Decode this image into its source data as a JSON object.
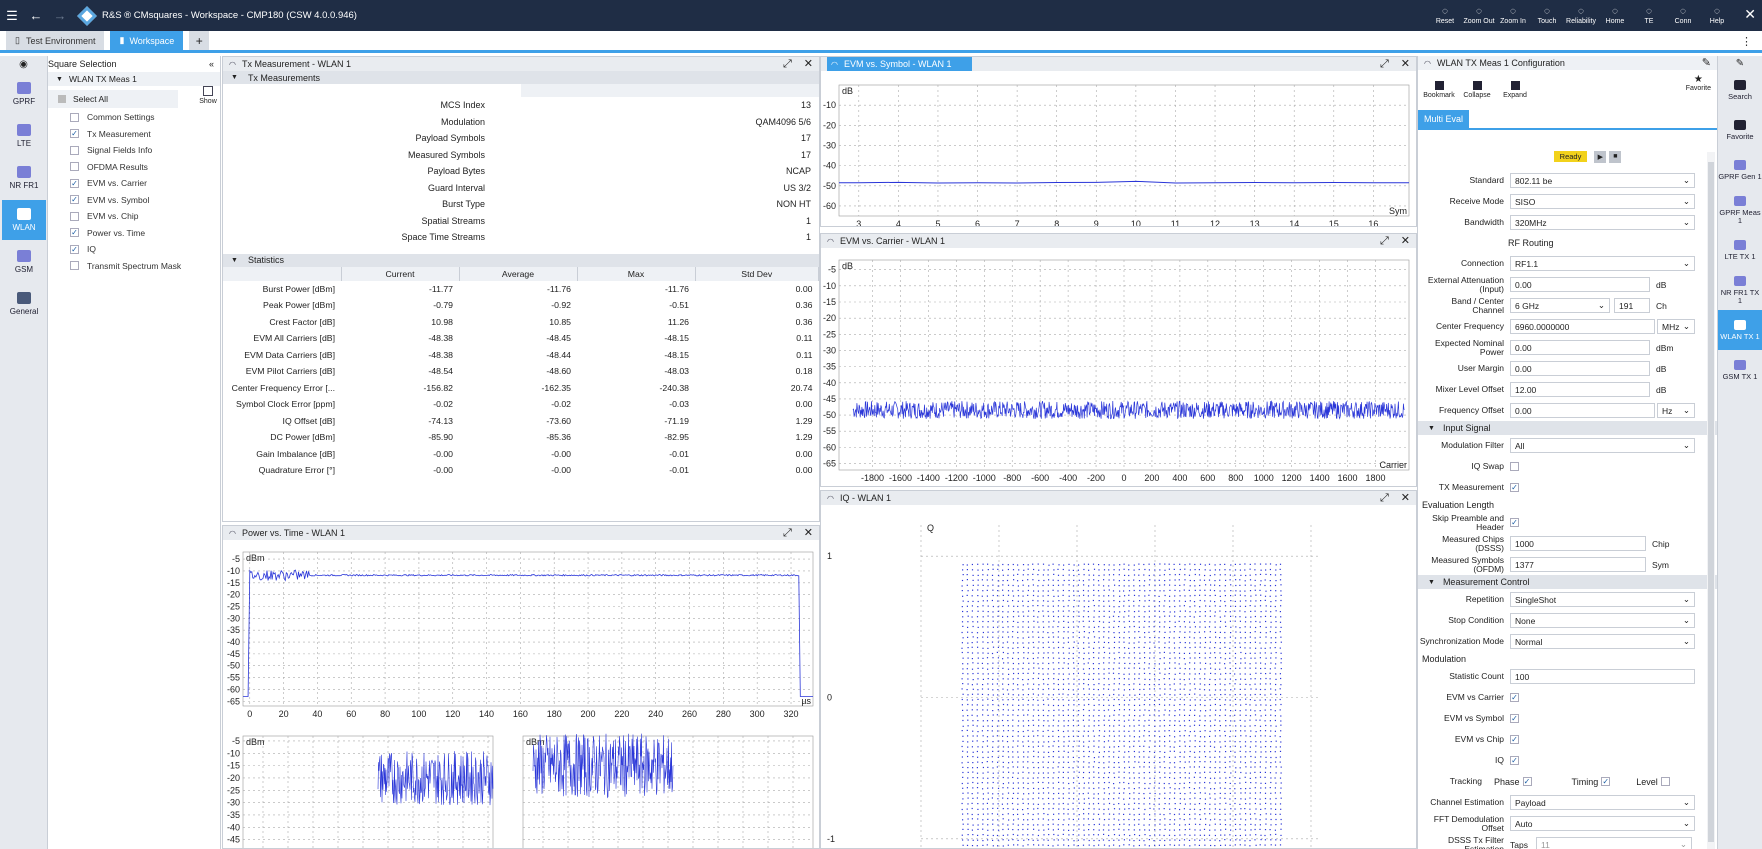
{
  "window": {
    "title": "R&S ® CMsquares - Workspace - CMP180 (CSW 4.0.0.946)"
  },
  "toolbar": [
    {
      "label": "Reset",
      "icon": "reset-icon"
    },
    {
      "label": "Zoom Out",
      "icon": "zoom-out-icon"
    },
    {
      "label": "Zoom In",
      "icon": "zoom-in-icon"
    },
    {
      "label": "Touch",
      "icon": "touch-icon"
    },
    {
      "label": "Reliability",
      "icon": "reliability-icon"
    },
    {
      "label": "Home",
      "icon": "home-icon"
    },
    {
      "label": "TE",
      "icon": "te-icon"
    },
    {
      "label": "Conn",
      "icon": "conn-icon"
    },
    {
      "label": "Help",
      "icon": "help-icon"
    }
  ],
  "tabs": [
    "Test Environment",
    "Workspace",
    "+"
  ],
  "square_selection": {
    "title": "Square Selection",
    "group": "WLAN TX Meas 1",
    "select_all": "Select All",
    "show": "Show",
    "items": [
      {
        "label": "Common Settings",
        "checked": false
      },
      {
        "label": "Tx Measurement",
        "checked": true
      },
      {
        "label": "Signal Fields Info",
        "checked": false
      },
      {
        "label": "OFDMA Results",
        "checked": false
      },
      {
        "label": "EVM vs. Carrier",
        "checked": true
      },
      {
        "label": "EVM vs. Symbol",
        "checked": true
      },
      {
        "label": "EVM vs. Chip",
        "checked": false
      },
      {
        "label": "Power vs. Time",
        "checked": true
      },
      {
        "label": "IQ",
        "checked": true
      },
      {
        "label": "Transmit Spectrum Mask",
        "checked": false
      }
    ]
  },
  "left_nav": [
    {
      "label": "GPRF"
    },
    {
      "label": "LTE"
    },
    {
      "label": "NR FR1"
    },
    {
      "label": "WLAN",
      "active": true
    },
    {
      "label": "GSM"
    },
    {
      "label": "General"
    }
  ],
  "tx_meas": {
    "title": "Tx Measurement - WLAN 1",
    "section": "Tx Measurements",
    "rows": [
      {
        "k": "MCS Index",
        "v": "13"
      },
      {
        "k": "Modulation",
        "v": "QAM4096 5/6"
      },
      {
        "k": "Payload Symbols",
        "v": "17"
      },
      {
        "k": "Measured Symbols",
        "v": "17"
      },
      {
        "k": "Payload Bytes",
        "v": "NCAP"
      },
      {
        "k": "Guard Interval",
        "v": "US 3/2"
      },
      {
        "k": "Burst Type",
        "v": "NON HT"
      },
      {
        "k": "Spatial Streams",
        "v": "1"
      },
      {
        "k": "Space Time Streams",
        "v": "1"
      }
    ],
    "stats_title": "Statistics",
    "stats_cols": [
      "Current",
      "Average",
      "Max",
      "Std Dev"
    ],
    "stats": [
      [
        "Burst Power [dBm]",
        "-11.77",
        "-11.76",
        "-11.76",
        "0.00"
      ],
      [
        "Peak Power [dBm]",
        "-0.79",
        "-0.92",
        "-0.51",
        "0.36"
      ],
      [
        "Crest Factor [dB]",
        "10.98",
        "10.85",
        "11.26",
        "0.36"
      ],
      [
        "EVM All Carriers [dB]",
        "-48.38",
        "-48.45",
        "-48.15",
        "0.11"
      ],
      [
        "EVM Data Carriers [dB]",
        "-48.38",
        "-48.44",
        "-48.15",
        "0.11"
      ],
      [
        "EVM Pilot Carriers [dB]",
        "-48.54",
        "-48.60",
        "-48.03",
        "0.18"
      ],
      [
        "Center Frequency Error [...",
        "-156.82",
        "-162.35",
        "-240.38",
        "20.74"
      ],
      [
        "Symbol Clock Error [ppm]",
        "-0.02",
        "-0.02",
        "-0.03",
        "0.00"
      ],
      [
        "IQ Offset [dB]",
        "-74.13",
        "-73.60",
        "-71.19",
        "1.29"
      ],
      [
        "DC Power [dBm]",
        "-85.90",
        "-85.36",
        "-82.95",
        "1.29"
      ],
      [
        "Gain Imbalance [dB]",
        "-0.00",
        "-0.00",
        "-0.01",
        "0.00"
      ],
      [
        "Quadrature Error [°]",
        "-0.00",
        "-0.00",
        "-0.01",
        "0.00"
      ]
    ]
  },
  "evm_symbol": {
    "title": "EVM vs. Symbol - WLAN 1"
  },
  "evm_carrier": {
    "title": "EVM vs. Carrier - WLAN 1"
  },
  "power_time": {
    "title": "Power vs. Time - WLAN 1"
  },
  "iq": {
    "title": "IQ - WLAN 1"
  },
  "chart_data": [
    {
      "type": "line",
      "name": "EVM vs. Symbol",
      "ylabel": "dB",
      "xlabel": "Sym",
      "x": [
        3,
        4,
        5,
        6,
        7,
        8,
        9,
        10,
        11,
        12,
        13,
        14,
        15,
        16
      ],
      "y": [
        -48.5,
        -48.3,
        -48.6,
        -48.5,
        -48.6,
        -48.4,
        -48.3,
        -47.8,
        -48.6,
        -48.5,
        -48.4,
        -48.5,
        -48.4,
        -48.5
      ],
      "xticks": [
        3,
        4,
        5,
        6,
        7,
        8,
        9,
        10,
        11,
        12,
        13,
        14,
        15,
        16
      ],
      "yticks": [
        -10,
        -20,
        -30,
        -40,
        -50,
        -60
      ],
      "ylim": [
        -65,
        0
      ],
      "xlim": [
        2.5,
        16.9
      ]
    },
    {
      "type": "line",
      "name": "EVM vs. Carrier",
      "ylabel": "dB",
      "xlabel": "Carrier",
      "xticks": [
        -1800,
        -1600,
        -1400,
        -1200,
        -1000,
        -800,
        -600,
        -400,
        -200,
        0,
        200,
        400,
        600,
        800,
        1000,
        1200,
        1400,
        1600,
        1800
      ],
      "yticks": [
        -5,
        -10,
        -15,
        -20,
        -25,
        -30,
        -35,
        -40,
        -45,
        -50,
        -55,
        -60,
        -65
      ],
      "ylim": [
        -67,
        -2
      ],
      "xlim": [
        -2040,
        2040
      ],
      "level": -48.4
    },
    {
      "type": "line",
      "name": "Power vs. Time",
      "ylabel": "dBm",
      "xlabel": "µs",
      "xticks": [
        0,
        20,
        40,
        60,
        80,
        100,
        120,
        140,
        160,
        180,
        200,
        220,
        240,
        260,
        280,
        300,
        320
      ],
      "yticks": [
        -5,
        -10,
        -15,
        -20,
        -25,
        -30,
        -35,
        -40,
        -45,
        -50,
        -55,
        -60,
        -65
      ],
      "ylim": [
        -67,
        -2
      ],
      "xlim": [
        -4,
        333
      ],
      "level": -11.8
    },
    {
      "type": "scatter",
      "name": "IQ",
      "ylabel": "Q",
      "yticks": [
        1,
        0,
        -1
      ]
    }
  ],
  "small_charts": {
    "ylabel": "dBm",
    "yticks": [
      -5,
      -10,
      -15,
      -20,
      -25,
      -30,
      -35,
      -40,
      -45
    ]
  },
  "config": {
    "title": "WLAN TX Meas 1 Configuration",
    "tools": [
      "Bookmark",
      "Collapse",
      "Expand"
    ],
    "favorite": "Favorite",
    "tab": "Multi Eval",
    "status": "Ready",
    "standard": "802.11 be",
    "receive_mode": "SISO",
    "bandwidth": "320MHz",
    "rf_routing": "RF Routing",
    "connection": "RF1.1",
    "ext_att": "0.00",
    "ext_att_unit": "dB",
    "band": "6 GHz",
    "channel": "191",
    "channel_unit": "Ch",
    "center_freq": "6960.0000000",
    "center_freq_unit": "MHz",
    "nominal_power": "0.00",
    "nominal_power_unit": "dBm",
    "user_margin": "0.00",
    "user_margin_unit": "dB",
    "mixer_level": "12.00",
    "mixer_level_unit": "dB",
    "freq_offset": "0.00",
    "freq_offset_unit": "Hz",
    "labels": {
      "standard": "Standard",
      "receive_mode": "Receive Mode",
      "bandwidth": "Bandwidth",
      "connection": "Connection",
      "ext_att": "External Attenuation (Input)",
      "band": "Band / Center Channel",
      "center_freq": "Center Frequency",
      "nominal_power": "Expected Nominal Power",
      "user_margin": "User Margin",
      "mixer_level": "Mixer Level Offset",
      "freq_offset": "Frequency Offset",
      "mod_filter": "Modulation Filter",
      "iq_swap": "IQ Swap",
      "tx_meas": "TX Measurement",
      "eval_len": "Evaluation Length",
      "skip": "Skip Preamble and Header",
      "chips": "Measured Chips (DSSS)",
      "symbols": "Measured Symbols (OFDM)",
      "repetition": "Repetition",
      "stop": "Stop Condition",
      "sync": "Synchronization Mode",
      "modulation": "Modulation",
      "stat_count": "Statistic Count",
      "evm_carrier": "EVM vs Carrier",
      "evm_symbol": "EVM vs Symbol",
      "evm_chip": "EVM vs Chip",
      "iq": "IQ",
      "tracking": "Tracking",
      "phase": "Phase",
      "timing": "Timing",
      "level": "Level",
      "chan_est": "Channel Estimation",
      "fft": "FFT Demodulation Offset",
      "dsss": "DSSS Tx Filter Estimation"
    },
    "input_signal": "Input Signal",
    "mod_filter": "All",
    "chips": "1000",
    "chips_unit": "Chip",
    "symbols": "1377",
    "symbols_unit": "Sym",
    "meas_control": "Measurement Control",
    "repetition": "SingleShot",
    "stop": "None",
    "sync": "Normal",
    "stat_count": "100",
    "chan_est": "Payload",
    "fft": "Auto",
    "dsss_val": "Taps",
    "dsss_num": "11"
  },
  "right_nav": [
    {
      "label": "Search"
    },
    {
      "label": "Favorite"
    },
    {
      "label": "GPRF Gen 1"
    },
    {
      "label": "GPRF Meas 1"
    },
    {
      "label": "LTE TX 1"
    },
    {
      "label": "NR FR1 TX 1"
    },
    {
      "label": "WLAN TX 1",
      "active": true
    },
    {
      "label": "GSM TX 1"
    }
  ]
}
